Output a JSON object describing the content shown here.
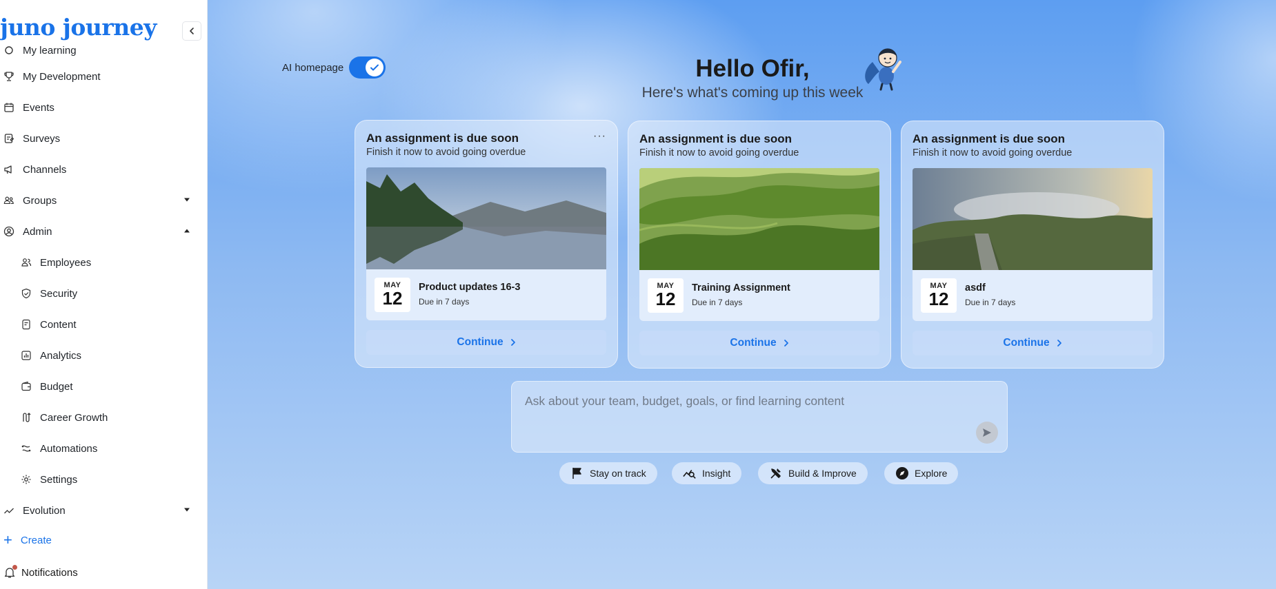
{
  "brand": {
    "logo_text": "juno journey",
    "accent": "#1a73e8"
  },
  "sidebar": {
    "partial_top_item": "My learning",
    "items": [
      {
        "label": "My Development",
        "icon": "trophy-icon"
      },
      {
        "label": "Events",
        "icon": "calendar-icon"
      },
      {
        "label": "Surveys",
        "icon": "survey-icon"
      },
      {
        "label": "Channels",
        "icon": "megaphone-icon"
      },
      {
        "label": "Groups",
        "icon": "people-icon",
        "expanded": false
      },
      {
        "label": "Admin",
        "icon": "user-circle-icon",
        "expanded": true
      }
    ],
    "admin_items": [
      {
        "label": "Employees",
        "icon": "employees-icon"
      },
      {
        "label": "Security",
        "icon": "shield-icon"
      },
      {
        "label": "Content",
        "icon": "document-icon"
      },
      {
        "label": "Analytics",
        "icon": "bar-chart-icon"
      },
      {
        "label": "Budget",
        "icon": "wallet-icon"
      },
      {
        "label": "Career Growth",
        "icon": "career-icon"
      },
      {
        "label": "Automations",
        "icon": "automation-icon"
      },
      {
        "label": "Settings",
        "icon": "gear-icon"
      }
    ],
    "partial_bottom_item": "Evolution",
    "create_label": "Create",
    "notifications_label": "Notifications"
  },
  "main": {
    "ai_homepage_label": "AI homepage",
    "ai_homepage_enabled": true,
    "greeting": "Hello Ofir,",
    "subheading": "Here's what's coming up this week",
    "cards": [
      {
        "title": "An assignment is due soon",
        "subtitle": "Finish it now to avoid going overdue",
        "month": "MAY",
        "day": "12",
        "name": "Product updates 16-3",
        "due": "Due in 7 days",
        "cta": "Continue",
        "menu": "···"
      },
      {
        "title": "An assignment is due soon",
        "subtitle": "Finish it now to avoid going overdue",
        "month": "MAY",
        "day": "12",
        "name": "Training Assignment",
        "due": "Due in 7 days",
        "cta": "Continue"
      },
      {
        "title": "An assignment is due soon",
        "subtitle": "Finish it now to avoid going overdue",
        "month": "MAY",
        "day": "12",
        "name": "asdf",
        "due": "Due in 7 days",
        "cta": "Continue"
      }
    ],
    "ask_placeholder": "Ask about your team, budget, goals, or find learning content",
    "chips": [
      {
        "label": "Stay on track",
        "icon": "flag-icon"
      },
      {
        "label": "Insight",
        "icon": "insight-icon"
      },
      {
        "label": "Build & Improve",
        "icon": "tools-icon"
      },
      {
        "label": "Explore",
        "icon": "compass-icon"
      }
    ]
  }
}
